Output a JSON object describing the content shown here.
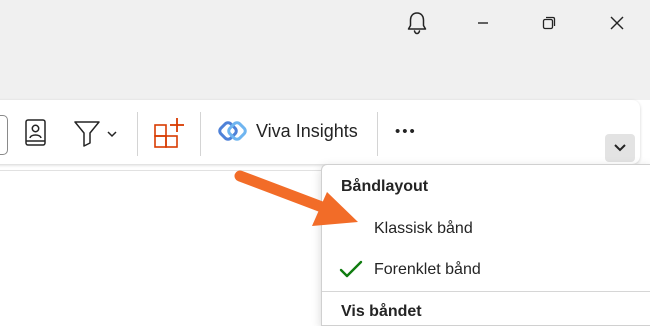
{
  "ribbon": {
    "viva_label": "Viva Insights",
    "more_label": "•••"
  },
  "colors": {
    "accent_arrow": "#f26c28",
    "check": "#107c10",
    "icon_orange": "#d83b01",
    "viva_blue": "#4e81d8"
  },
  "menu": {
    "header": "Båndlayout",
    "items": [
      {
        "label": "Klassisk bånd",
        "checked": false
      },
      {
        "label": "Forenklet bånd",
        "checked": true
      }
    ],
    "header2": "Vis båndet"
  }
}
